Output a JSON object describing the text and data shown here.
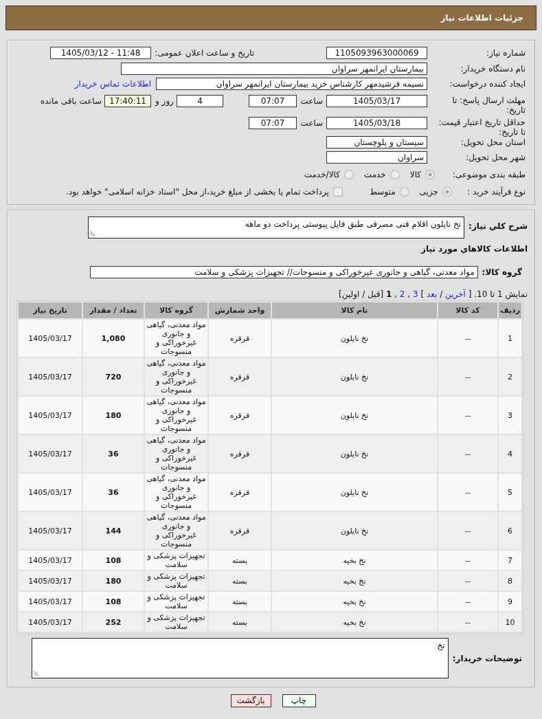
{
  "header": {
    "title": "جزئیات اطلاعات نیاز"
  },
  "form": {
    "need_number": {
      "label": "شماره نیاز:",
      "value": "1105093963000069"
    },
    "announce": {
      "label": "تاریخ و ساعت اعلان عمومی:",
      "value": "1405/03/12 - 11:48"
    },
    "buyer_org": {
      "label": "نام دستگاه خریدار:",
      "value": "بیمارستان ایرانمهر سراوان"
    },
    "creator": {
      "label": "ایجاد کننده درخواست:",
      "value": "نسیمه فرشیدمهر کارشناس خرید بیمارستان ایرانمهر سراوان",
      "link": "اطلاعات تماس خریدار"
    },
    "reply_deadline": {
      "label": "مهلت ارسال پاسخ: تا تاریخ:",
      "date": "1405/03/17",
      "time_label": "ساعت",
      "time": "07:07",
      "days": "4",
      "days_label": "روز و",
      "remaining": "17:40:11",
      "remaining_label": "ساعت باقی مانده"
    },
    "price_validity": {
      "label": "حداقل تاریخ اعتبار قیمت: تا تاریخ:",
      "date": "1405/03/18",
      "time_label": "ساعت",
      "time": "07:07"
    },
    "province": {
      "label": "استان محل تحویل:",
      "value": "سیستان و بلوچستان"
    },
    "city": {
      "label": "شهر محل تحویل:",
      "value": "سراوان"
    },
    "category": {
      "label": "طبقه بندی موضوعی:",
      "options": [
        {
          "label": "کالا",
          "selected": true
        },
        {
          "label": "خدمت",
          "selected": false
        },
        {
          "label": "کالا/خدمت",
          "selected": false
        }
      ]
    },
    "purchase_type": {
      "label": "نوع فرآیند خرید :",
      "options": [
        {
          "label": "جزیی",
          "selected": true
        },
        {
          "label": "متوسط",
          "selected": false
        }
      ],
      "treasury": {
        "label": "پرداخت تمام یا بخشی از مبلغ خرید،از محل \"اسناد خزانه اسلامی\" خواهد بود.",
        "checked": false
      }
    }
  },
  "details": {
    "description": {
      "label": "شرح کلي نیاز:",
      "value": "نخ نایلون اقلام فنی مصرفی طبق فایل پیوستی پرداخت دو ماهه"
    },
    "section_title": "اطلاعات کالاهاي مورد نیاز",
    "goods_group": {
      "label": "گروه کالا:",
      "value": "مواد معدنی، گیاهی و جانوری غیرخوراکی و منسوجات// تجهیزات پزشکی و سلامت"
    },
    "pagination": [
      {
        "kind": "text",
        "text": "نمایش 1 تا 10. ["
      },
      {
        "kind": "link",
        "text": "آخرین"
      },
      {
        "kind": "text",
        "text": "/"
      },
      {
        "kind": "link",
        "text": "بعد"
      },
      {
        "kind": "text",
        "text": "]"
      },
      {
        "kind": "link",
        "text": "3"
      },
      {
        "kind": "text",
        "text": ","
      },
      {
        "kind": "link",
        "text": "2"
      },
      {
        "kind": "text",
        "text": ","
      },
      {
        "kind": "current",
        "text": "1"
      },
      {
        "kind": "text",
        "text": "[قبل / اولین]"
      }
    ],
    "table": {
      "columns": [
        "ردیف",
        "کد کالا",
        "نام کالا",
        "واحد شمارش",
        "گروه کالا",
        "تعداد / مقدار",
        "تاریخ نیاز"
      ],
      "rows": [
        {
          "index": "1",
          "code": "--",
          "name": "نخ نایلون",
          "unit": "قرقره",
          "group": "مواد معدنی، گیاهی و جانوری غیرخوراکی و منسوجات",
          "quantity": "1,080",
          "date": "1405/03/17"
        },
        {
          "index": "2",
          "code": "--",
          "name": "نخ نایلون",
          "unit": "قرقره",
          "group": "مواد معدنی، گیاهی و جانوری غیرخوراکی و منسوجات",
          "quantity": "720",
          "date": "1405/03/17"
        },
        {
          "index": "3",
          "code": "--",
          "name": "نخ نایلون",
          "unit": "قرقره",
          "group": "مواد معدنی، گیاهی و جانوری غیرخوراکی و منسوجات",
          "quantity": "180",
          "date": "1405/03/17"
        },
        {
          "index": "4",
          "code": "--",
          "name": "نخ نایلون",
          "unit": "قرقره",
          "group": "مواد معدنی، گیاهی و جانوری غیرخوراکی و منسوجات",
          "quantity": "36",
          "date": "1405/03/17"
        },
        {
          "index": "5",
          "code": "--",
          "name": "نخ نایلون",
          "unit": "قرقره",
          "group": "مواد معدنی، گیاهی و جانوری غیرخوراکی و منسوجات",
          "quantity": "36",
          "date": "1405/03/17"
        },
        {
          "index": "6",
          "code": "--",
          "name": "نخ نایلون",
          "unit": "قرقره",
          "group": "مواد معدنی، گیاهی و جانوری غیرخوراکی و منسوجات",
          "quantity": "144",
          "date": "1405/03/17"
        },
        {
          "index": "7",
          "code": "--",
          "name": "نخ بخیه",
          "unit": "بسته",
          "group": "تجهیزات پزشکی و سلامت",
          "quantity": "108",
          "date": "1405/03/17"
        },
        {
          "index": "8",
          "code": "--",
          "name": "نخ بخیه",
          "unit": "بسته",
          "group": "تجهیزات پزشکی و سلامت",
          "quantity": "180",
          "date": "1405/03/17"
        },
        {
          "index": "9",
          "code": "--",
          "name": "نخ بخیه",
          "unit": "بسته",
          "group": "تجهیزات پزشکی و سلامت",
          "quantity": "108",
          "date": "1405/03/17"
        },
        {
          "index": "10",
          "code": "--",
          "name": "نخ بخیه",
          "unit": "بسته",
          "group": "تجهیزات پزشکی و سلامت",
          "quantity": "252",
          "date": "1405/03/17"
        }
      ]
    },
    "buyer_notes": {
      "label": "توضیحات خریدار:",
      "value": "نخ"
    }
  },
  "buttons": [
    {
      "label": "چاپ",
      "kind": "print"
    },
    {
      "label": "بازگشت",
      "kind": "back"
    }
  ]
}
